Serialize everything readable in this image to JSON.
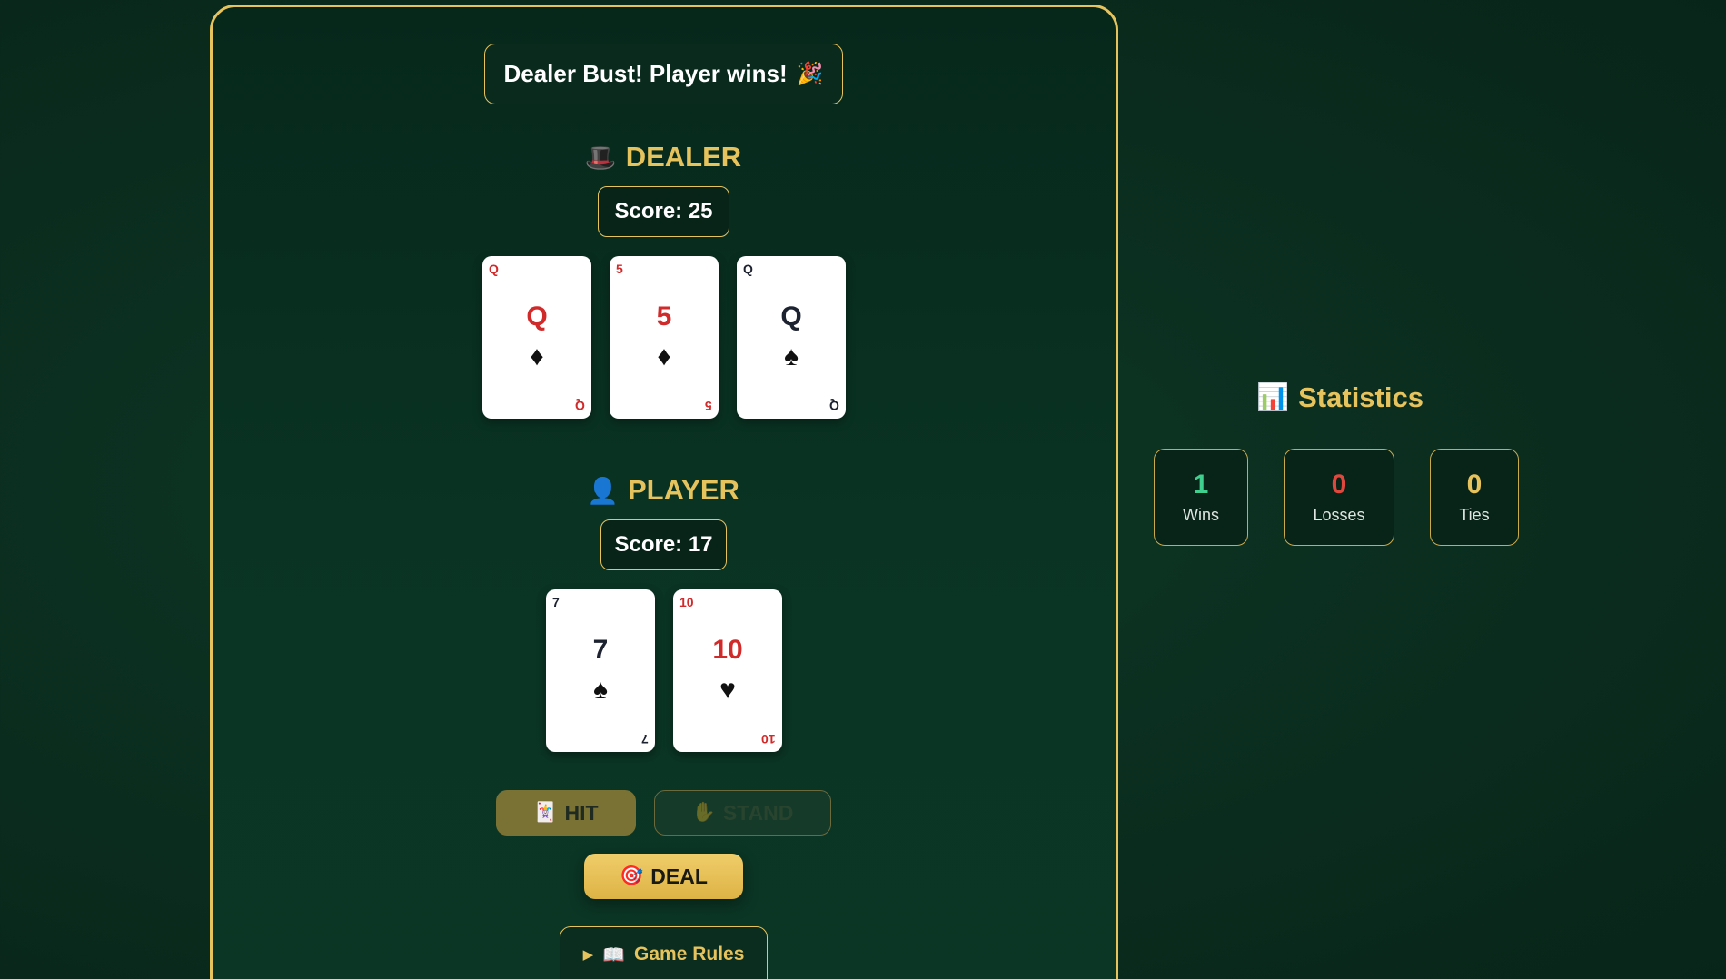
{
  "status": {
    "message": "Dealer Bust! Player wins!",
    "emoji": "🎉"
  },
  "dealer": {
    "emoji": "🎩",
    "title": "DEALER",
    "score_label": "Score: 25",
    "cards": [
      {
        "rank": "Q",
        "suit": "♦",
        "color": "red"
      },
      {
        "rank": "5",
        "suit": "♦",
        "color": "red"
      },
      {
        "rank": "Q",
        "suit": "♠",
        "color": "black"
      }
    ]
  },
  "player": {
    "emoji": "👤",
    "title": "PLAYER",
    "score_label": "Score: 17",
    "cards": [
      {
        "rank": "7",
        "suit": "♠",
        "color": "black"
      },
      {
        "rank": "10",
        "suit": "♥",
        "color": "red"
      }
    ]
  },
  "controls": {
    "hit": {
      "emoji": "🃏",
      "label": "HIT"
    },
    "stand": {
      "emoji": "✋",
      "label": "STAND"
    },
    "deal": {
      "emoji": "🎯",
      "label": "DEAL"
    }
  },
  "rules": {
    "arrow": "▶",
    "emoji": "📖",
    "label": "Game Rules"
  },
  "statistics": {
    "emoji": "📊",
    "title": "Statistics",
    "wins": {
      "value": "1",
      "label": "Wins",
      "color": "#3fcf8e"
    },
    "losses": {
      "value": "0",
      "label": "Losses",
      "color": "#e0483e"
    },
    "ties": {
      "value": "0",
      "label": "Ties",
      "color": "#e6c35c"
    }
  },
  "colors": {
    "accent": "#e6c35c",
    "felt": "#0b3625",
    "card_red": "#d12a2a",
    "card_black": "#1d2230"
  }
}
